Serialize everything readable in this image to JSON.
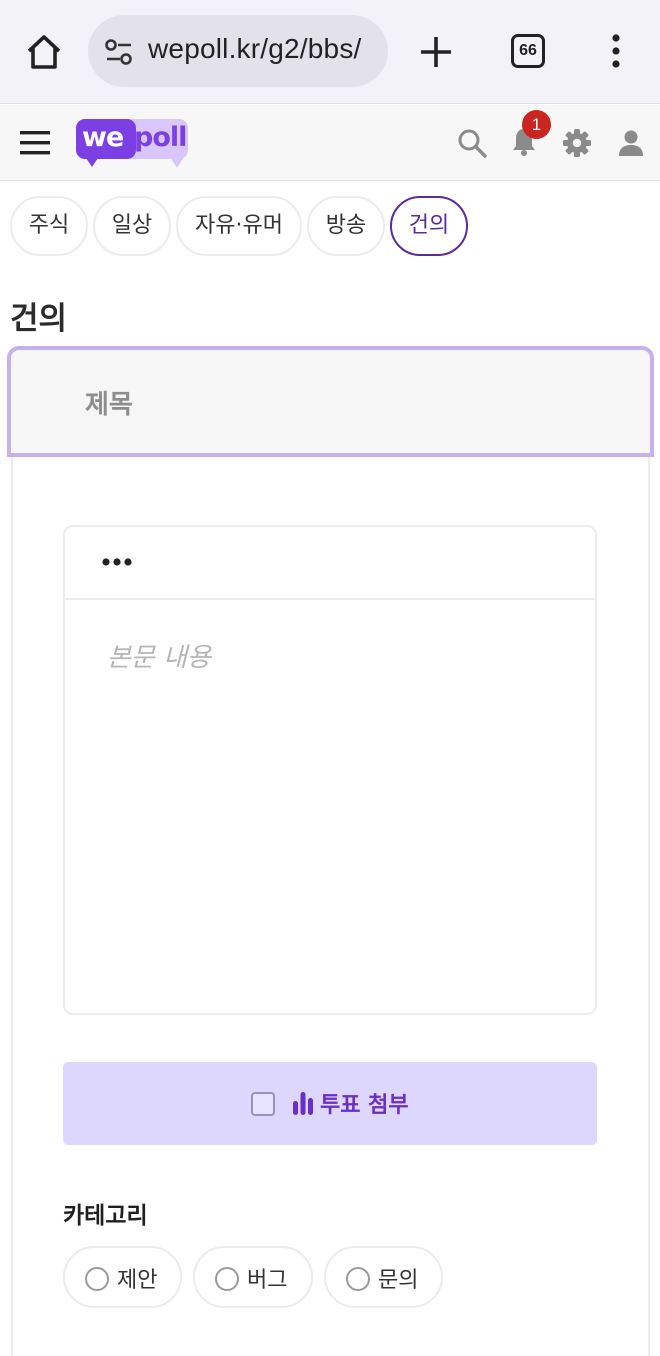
{
  "browser": {
    "url": "wepoll.kr/g2/bbs/",
    "tab_count": "66"
  },
  "header": {
    "logo_we": "we",
    "logo_poll": "poll",
    "notification_count": "1"
  },
  "categories": [
    {
      "label": "주식",
      "active": false
    },
    {
      "label": "일상",
      "active": false
    },
    {
      "label": "자유·유머",
      "active": false
    },
    {
      "label": "방송",
      "active": false
    },
    {
      "label": "건의",
      "active": true
    }
  ],
  "page": {
    "title": "건의"
  },
  "form": {
    "title_placeholder": "제목",
    "body_placeholder": "본문 내용",
    "poll_attach_label": "투표 첨부",
    "poll_attach_checked": false,
    "category_label": "카테고리",
    "category_options": [
      {
        "label": "제안",
        "selected": false
      },
      {
        "label": "버그",
        "selected": false
      },
      {
        "label": "문의",
        "selected": false
      }
    ]
  },
  "colors": {
    "accent": "#7b3fe4",
    "active_tab": "#5b2a9c",
    "title_border": "#c7b1ec",
    "poll_bg": "#ddd6fd",
    "badge": "#c8261f"
  }
}
